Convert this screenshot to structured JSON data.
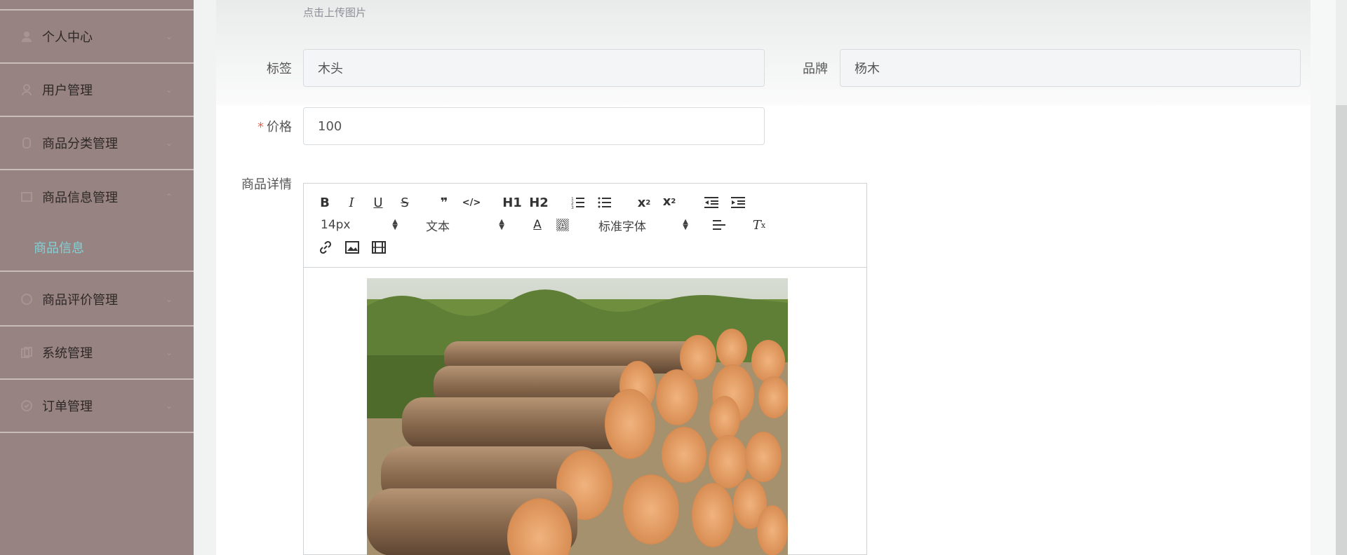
{
  "sidebar": {
    "items": [
      {
        "label": "个人中心",
        "icon": "user-icon"
      },
      {
        "label": "用户管理",
        "icon": "users-icon"
      },
      {
        "label": "商品分类管理",
        "icon": "category-icon"
      },
      {
        "label": "商品信息管理",
        "icon": "goods-icon",
        "expanded": true
      },
      {
        "label": "商品评价管理",
        "icon": "comment-icon"
      },
      {
        "label": "系统管理",
        "icon": "settings-icon"
      },
      {
        "label": "订单管理",
        "icon": "order-icon"
      }
    ],
    "submenu": {
      "label": "商品信息"
    }
  },
  "form": {
    "upload_hint": "点击上传图片",
    "tag": {
      "label": "标签",
      "value": "木头"
    },
    "brand": {
      "label": "品牌",
      "value": "杨木"
    },
    "price": {
      "label": "价格",
      "value": "100",
      "required": true
    },
    "detail": {
      "label": "商品详情"
    }
  },
  "editor": {
    "toolbar": {
      "bold": "B",
      "italic": "I",
      "underline": "U",
      "strike": "S",
      "quote": "❞",
      "code": "</>",
      "h1": "H1",
      "h2": "H2",
      "font_size": "14px",
      "header_type": "文本",
      "font_family": "标准字体"
    },
    "content_image": "stacked-logs-photo"
  },
  "colors": {
    "sidebar_bg": "#978381",
    "active_text": "#7fd3d9",
    "required_mark": "#e06a55"
  }
}
